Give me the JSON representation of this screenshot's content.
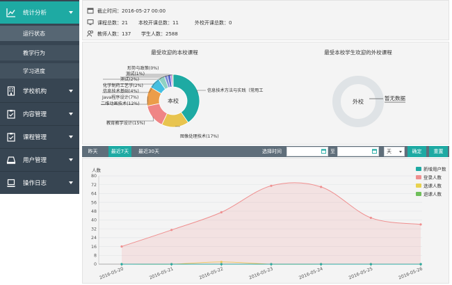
{
  "sidebar": {
    "items": [
      {
        "label": "统计分析",
        "icon": "line-chart-icon"
      },
      {
        "label": "学校机构",
        "icon": "building-icon"
      },
      {
        "label": "内容管理",
        "icon": "clipboard-icon"
      },
      {
        "label": "课程管理",
        "icon": "clipboard-check-icon"
      },
      {
        "label": "用户管理",
        "icon": "user-card-icon"
      },
      {
        "label": "操作日志",
        "icon": "laptop-icon"
      }
    ],
    "subitems": [
      {
        "label": "运行状态"
      },
      {
        "label": "教学行为"
      },
      {
        "label": "学习进度"
      }
    ]
  },
  "info": {
    "deadline": "截止时间：2016-05-27 00:00",
    "courses_total": "课程总数：21",
    "school_courses": "本校开课总数：11",
    "external_courses": "外校开课总数：0",
    "teachers": "教师人数：137",
    "students": "学生人数：2588"
  },
  "donut_left": {
    "title": "最受欢迎的本校课程",
    "center": "本校",
    "slices": [
      {
        "label": "信息技术方法与实践（常用工",
        "value": 41,
        "color": "#1eaaa3"
      },
      {
        "label": "图像处理技术(17%)",
        "value": 17,
        "color": "#e8c44f"
      },
      {
        "label": "教育教学设计(15%)",
        "value": 15,
        "color": "#ef8585"
      },
      {
        "label": "二维动画技术(12%)",
        "value": 12,
        "color": "#eb9d4a"
      },
      {
        "label": "Java程序设计(7%)",
        "value": 7,
        "color": "#45bfe0"
      },
      {
        "label": "信息技术基础(4%)",
        "value": 4,
        "color": "#8fd1c3"
      },
      {
        "label": "化学制药工艺学(2%)",
        "value": 2,
        "color": "#7f8fd6"
      },
      {
        "label": "测试(2%)",
        "value": 2,
        "color": "#5b6acb"
      },
      {
        "label": "测试(1%)",
        "value": 1,
        "color": "#b46fd3"
      },
      {
        "label": "形势与政策(0%)",
        "value": 0.6,
        "color": "#6fbf5a"
      }
    ]
  },
  "donut_right": {
    "title": "最受本校学生欢迎的外校课程",
    "center": "外校",
    "empty_label": "暂无数据"
  },
  "filter": {
    "tabs": [
      "昨天",
      "最近7天",
      "最近30天"
    ],
    "active_tab": 1,
    "select_time": "选择时间",
    "to": "至",
    "unit": "天",
    "confirm": "确定",
    "reset": "重置"
  },
  "chart_data": {
    "type": "line",
    "ylabel": "人数",
    "ylim": [
      0,
      80
    ],
    "yticks": [
      0,
      8,
      16,
      24,
      32,
      40,
      48,
      56,
      64,
      72,
      80
    ],
    "x": [
      "2016-05-20",
      "2016-05-21",
      "2016-05-22",
      "2016-05-23",
      "2016-05-24",
      "2016-05-25",
      "2016-05-26"
    ],
    "series": [
      {
        "name": "新增用户数",
        "color": "#1eaaa3",
        "values": [
          0,
          0,
          0,
          0,
          0,
          0,
          0
        ]
      },
      {
        "name": "登录人数",
        "color": "#ef8f8f",
        "values": [
          16,
          31,
          47,
          71,
          70,
          42,
          36
        ]
      },
      {
        "name": "选课人数",
        "color": "#e8d24f",
        "values": [
          0,
          0,
          2,
          0,
          0,
          0,
          0
        ]
      },
      {
        "name": "退课人数",
        "color": "#6fbf5a",
        "values": [
          0,
          0,
          0,
          0,
          0,
          0,
          0
        ]
      }
    ]
  }
}
